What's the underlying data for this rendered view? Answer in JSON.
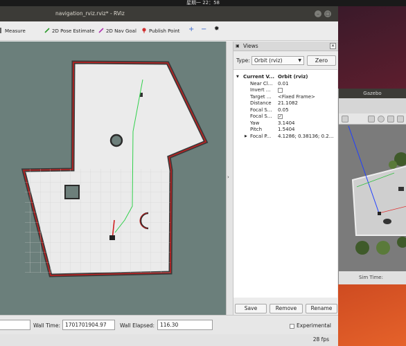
{
  "system": {
    "clock": "星期一 22：58"
  },
  "rviz": {
    "window_title": "navigation_rviz.rviz* - RViz",
    "toolbar": {
      "measure": "Measure",
      "pose_estimate": "2D Pose Estimate",
      "nav_goal": "2D Nav Goal",
      "publish_point": "Publish Point"
    },
    "views": {
      "panel_title": "Views",
      "type_label": "Type:",
      "type_value": "Orbit (rviz)",
      "zero_label": "Zero",
      "current_view": {
        "key": "Current V...",
        "value": "Orbit (rviz)"
      },
      "properties": [
        {
          "key": "Near Cl...",
          "value": "0.01"
        },
        {
          "key": "Invert ...",
          "value": ""
        },
        {
          "key": "Target ...",
          "value": "<Fixed Frame>"
        },
        {
          "key": "Distance",
          "value": "21.1082"
        },
        {
          "key": "Focal S...",
          "value": "0.05"
        },
        {
          "key": "Focal S...",
          "value": "✓"
        },
        {
          "key": "Yaw",
          "value": "3.1404"
        },
        {
          "key": "Pitch",
          "value": "1.5404"
        },
        {
          "key": "Focal P...",
          "value": "4.1286; 0.38136; 0.2..."
        }
      ],
      "save_label": "Save",
      "remove_label": "Remove",
      "rename_label": "Rename"
    },
    "time": {
      "wall_time_label": "Wall Time:",
      "wall_time_value": "1701701904.97",
      "wall_elapsed_label": "Wall Elapsed:",
      "wall_elapsed_value": "116.30",
      "experimental_label": "Experimental"
    },
    "fps": "28 fps"
  },
  "gazebo": {
    "window_title": "Gazebo",
    "sim_time_label": "Sim Time:"
  }
}
